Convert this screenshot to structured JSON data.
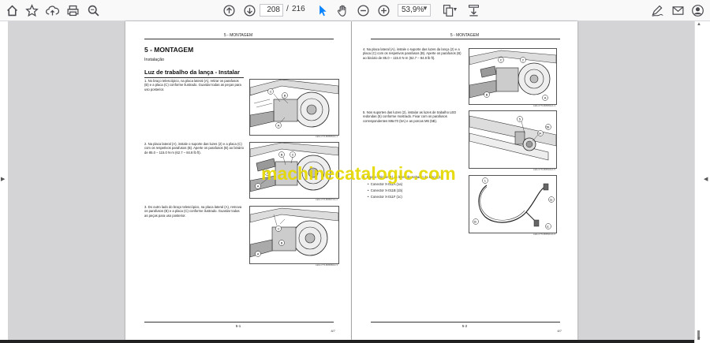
{
  "toolbar": {
    "page_current": "208",
    "page_sep": "/",
    "page_total": "216",
    "zoom": "53,9%",
    "icons": [
      "home-icon",
      "star-icon",
      "upload-icon",
      "print-icon",
      "search-icon",
      "page-up-icon",
      "page-down-icon",
      "select-cursor-icon",
      "hand-tool-icon",
      "zoom-out-icon",
      "zoom-in-icon",
      "page-layout-icon",
      "download-icon",
      "sign-icon",
      "mail-icon",
      "user-icon"
    ]
  },
  "page1": {
    "header": "5 - MONTAGEM",
    "title": "5 - MONTAGEM",
    "subtitle": "Instalação",
    "section": "Luz de trabalho da lança - Instalar",
    "step1": "1.   No braço telescópico, na placa lateral (A), retirar os parafusos (B) e a placa (C) conforme ilustrado. Guardar todas as peças para uso posterior.",
    "step2": "2.   Na placa lateral (A), instale o suporte das luzes (2) e a placa (C) com os respetivos parafusos (B). Aperte os parafusos (B) ao binário de 85.0 – 115.0 N·m (62.7 – 84.8 lb ft).",
    "step3": "3.   Do outro lado do braço telescópico, na placa lateral (A), remova os parafusos (B) e a placa (C) conforme ilustrado. Guardar todas as peças para uso posterior.",
    "fig1_caption": "LEIL17TLB0586AA   1",
    "fig2_caption": "LEIL17TLB0587AA   2",
    "fig3_caption": "LEIL17TLB0588AA   3",
    "page_number": "5-1",
    "rev": "8/7"
  },
  "page2": {
    "header": "5 - MONTAGEM",
    "step4": "4.   Na placa lateral (A), instale o suporte das luzes da lança (2) e a placa (C) com os respetivos parafusos (B). Aperte os parafusos (B) ao binário de 85.0 – 115.0 N·m (62.7 – 84.8 lb ft).",
    "step5": "5.   Nos suportes das luzes (2), instalar as luzes de trabalho LED redondas (5) conforme mostrado. Fixar com os parafusos correspondentes M6x70 (5A) e as porcas M6 (5B).",
    "step6": "6.   Ligar o chicote (1) às luzes de trabalho da lança (1)",
    "bullets": [
      "Conector X-011A (1a)",
      "Conector X-011B (1b)",
      "Conector X-011F (1c)"
    ],
    "fig4_caption": "LEIL17TLB0589AA   4",
    "fig5_caption": "LEIL17TLB0590AA   5",
    "fig6_caption": "LEIL17TLB0591AA   6",
    "page_number": "5-2",
    "rev": "8/7"
  },
  "watermark": "machinecatalogic.com",
  "colors": {
    "watermark": "#e6d800",
    "background": "#d4d4d7",
    "toolbar": "#f9f9fa"
  }
}
